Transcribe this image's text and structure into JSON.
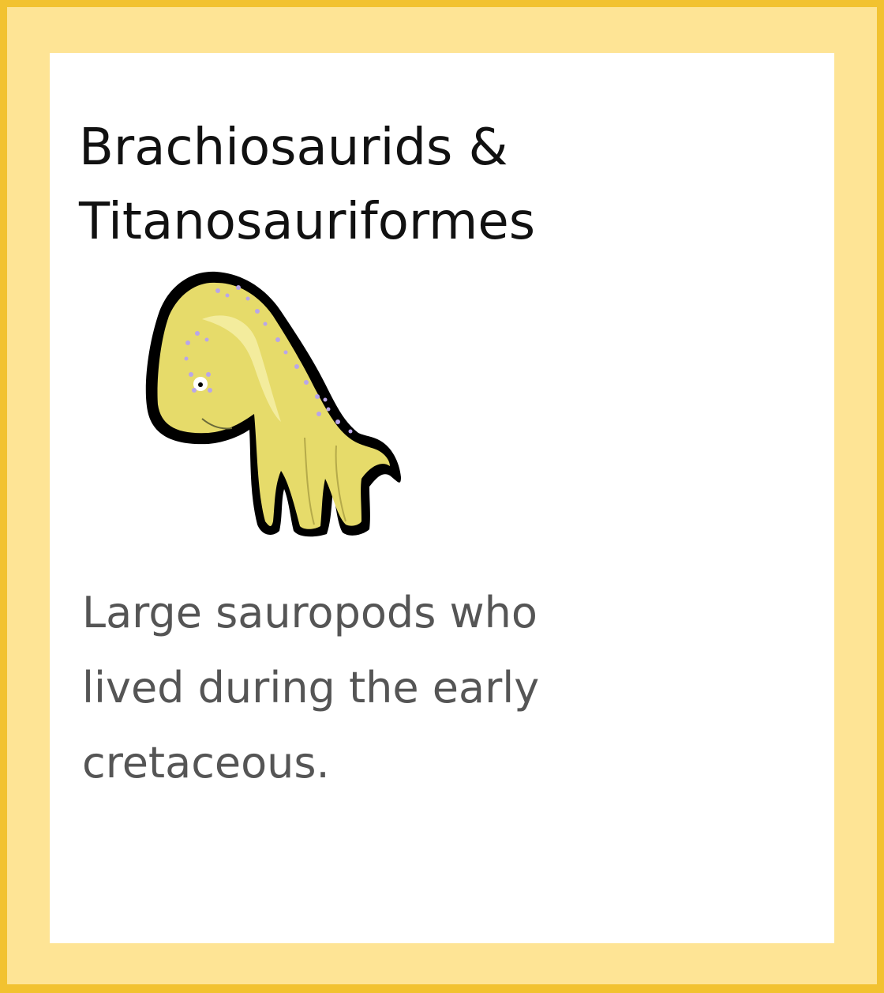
{
  "card": {
    "title_lines": [
      "Brachiosaurids &",
      "Titanosauriformes"
    ],
    "description_lines": [
      "Large sauropods who",
      "lived during the early",
      "cretaceous."
    ]
  },
  "illustration": {
    "icon": "sauropod-dinosaur-icon",
    "body_color": "#e6db6a",
    "highlight_color": "#f3ec9d",
    "outline_color": "#000000",
    "spot_color": "#b9a6e8"
  },
  "colors": {
    "outer_border": "#f2c230",
    "inner_border": "#fee495",
    "card_background": "#ffffff",
    "title_text": "#111111",
    "description_text": "#555555"
  }
}
